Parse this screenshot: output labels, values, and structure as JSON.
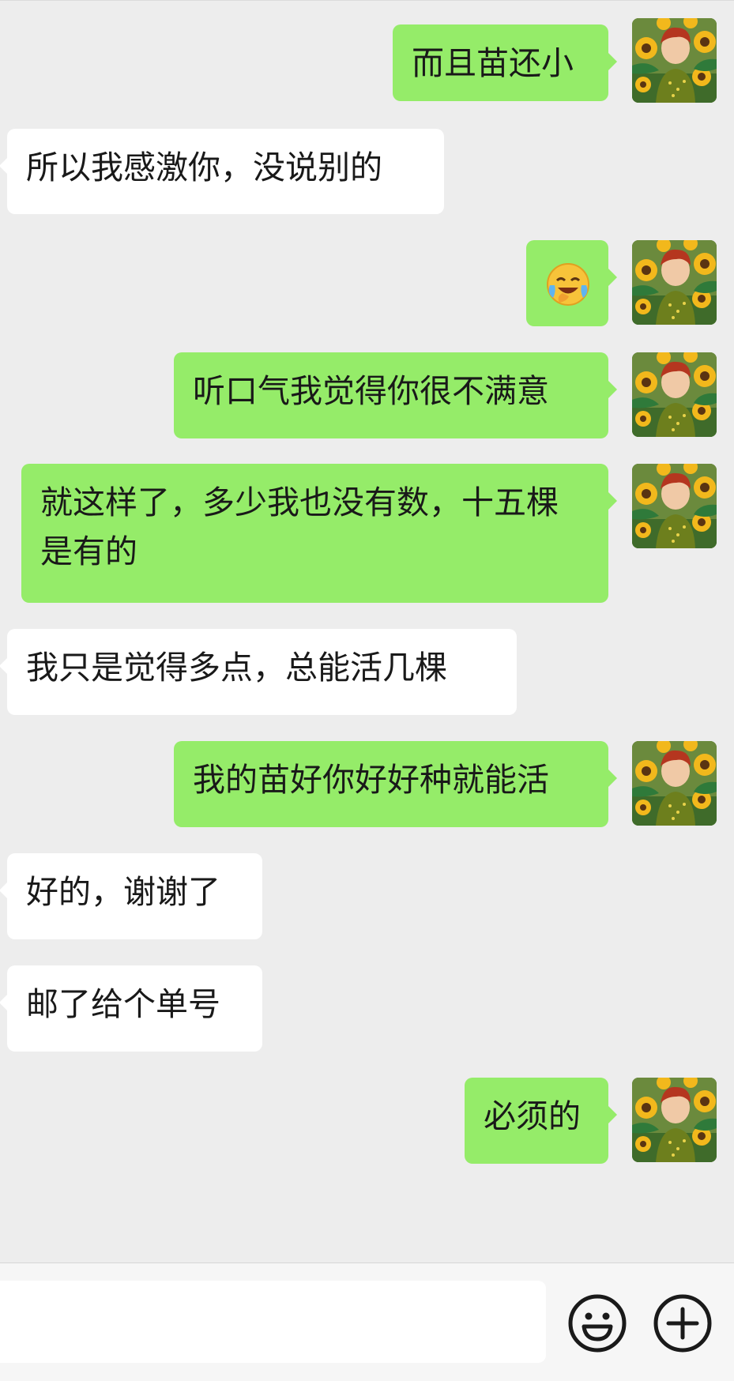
{
  "conversation": {
    "messages": [
      {
        "side": "out",
        "text": "而且苗还小"
      },
      {
        "side": "in",
        "text": "所以我感激你，没说别的"
      },
      {
        "side": "out",
        "emoji": "laughing-crying-emoji",
        "text": ""
      },
      {
        "side": "out",
        "text": "听口气我觉得你很不满意"
      },
      {
        "side": "out",
        "text": "就这样了，多少我也没有数，十五棵是有的"
      },
      {
        "side": "in",
        "text": "我只是觉得多点，总能活几棵"
      },
      {
        "side": "out",
        "text": "我的苗好你好好种就能活"
      },
      {
        "side": "in",
        "text": "好的，谢谢了"
      },
      {
        "side": "in",
        "text": "邮了给个单号"
      },
      {
        "side": "out",
        "text": "必须的"
      }
    ]
  },
  "input_bar": {
    "text_value": "",
    "emoji_icon": "smiley-face-icon",
    "plus_icon": "plus-circle-icon"
  },
  "colors": {
    "background": "#ededed",
    "outgoing_bubble": "#95ec69",
    "incoming_bubble": "#ffffff",
    "text": "#191919"
  }
}
